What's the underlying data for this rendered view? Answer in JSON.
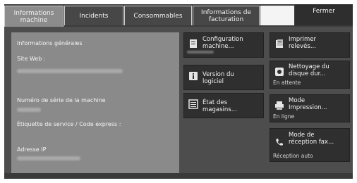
{
  "tabs": [
    {
      "label": "Informations machine"
    },
    {
      "label": "Incidents"
    },
    {
      "label": "Consommables"
    },
    {
      "label": "Informations de facturation"
    }
  ],
  "close_label": "Fermer",
  "info_panel": {
    "section_title": "Informations générales",
    "website_label": "Site Web :",
    "serial_label": "Numéro de série de la machine",
    "service_tag_label": "Étiquette de service / Code express :",
    "ip_label": "Adresse IP"
  },
  "buttons": {
    "configuration": {
      "label": "Configuration machine..."
    },
    "software_version": {
      "label": "Version du logiciel"
    },
    "trays_status": {
      "label": "État des magasins..."
    },
    "print_reports": {
      "label": "Imprimer relevés..."
    },
    "disk_cleanup": {
      "label": "Nettoyage du disque dur...",
      "status": "En attente"
    },
    "print_mode": {
      "label": "Mode Impression...",
      "status": "En ligne"
    },
    "fax_receive_mode": {
      "label": "Mode de réception fax...",
      "status": "Réception auto"
    }
  },
  "icons": [
    "document-icon",
    "info-icon",
    "list-icon",
    "print-report-icon",
    "disk-icon",
    "printer-icon",
    "phone-icon"
  ],
  "colors": {
    "screen_bg": "#4d4d4d",
    "panel_bg": "#8a8a8a",
    "button_bg": "#2f2f2f",
    "active_tab": "#8c8c8c"
  }
}
